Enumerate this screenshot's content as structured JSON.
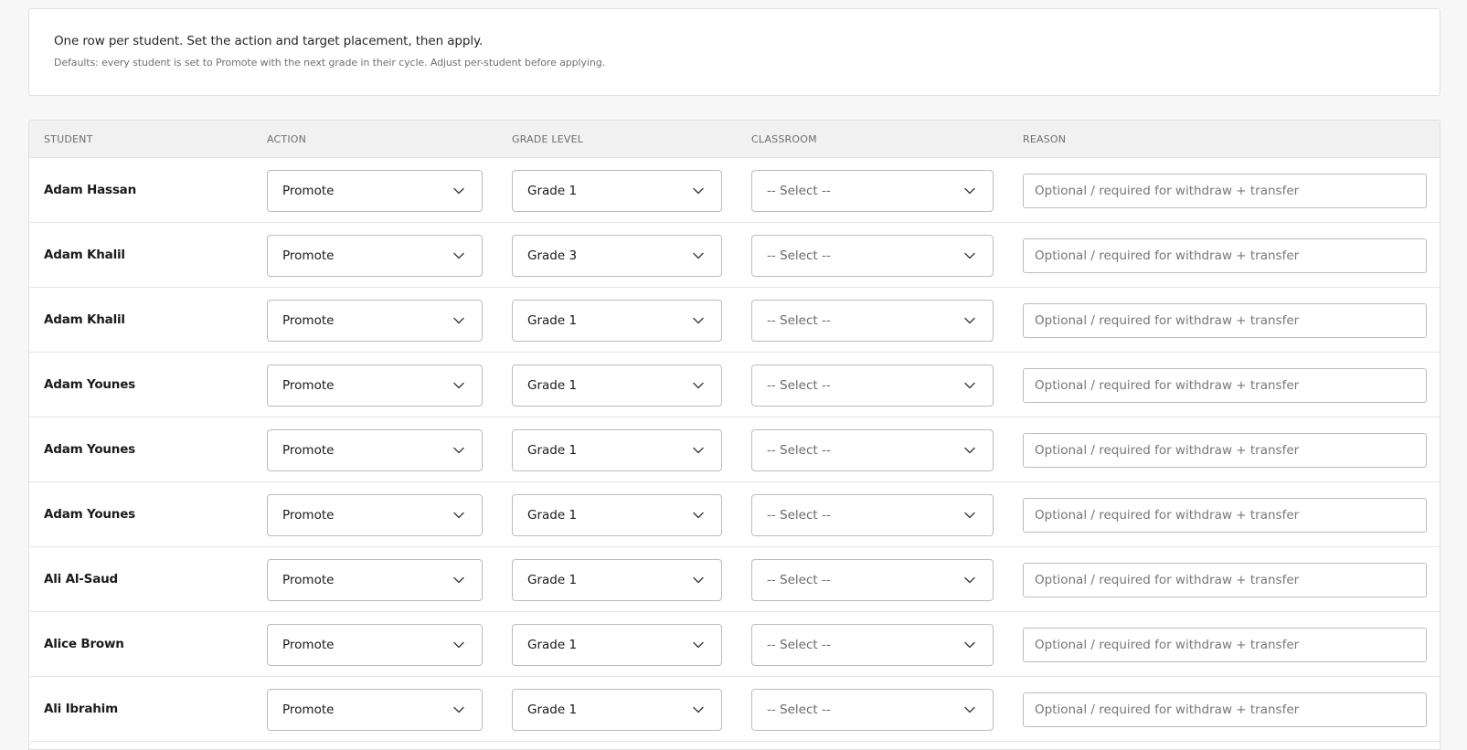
{
  "info": {
    "main": "One row per student. Set the action and target placement, then apply.",
    "sub": "Defaults: every student is set to Promote with the next grade in their cycle. Adjust per-student before applying."
  },
  "table": {
    "headers": {
      "student": "STUDENT",
      "action": "ACTION",
      "grade_level": "GRADE LEVEL",
      "classroom": "CLASSROOM",
      "reason": "REASON"
    },
    "reason_placeholder": "Optional / required for withdraw + transfer",
    "rows": [
      {
        "student": "Adam Hassan",
        "action": "Promote",
        "grade": "Grade 1",
        "classroom": "-- Select --"
      },
      {
        "student": "Adam Khalil",
        "action": "Promote",
        "grade": "Grade 3",
        "classroom": "-- Select --"
      },
      {
        "student": "Adam Khalil",
        "action": "Promote",
        "grade": "Grade 1",
        "classroom": "-- Select --"
      },
      {
        "student": "Adam Younes",
        "action": "Promote",
        "grade": "Grade 1",
        "classroom": "-- Select --"
      },
      {
        "student": "Adam Younes",
        "action": "Promote",
        "grade": "Grade 1",
        "classroom": "-- Select --"
      },
      {
        "student": "Adam Younes",
        "action": "Promote",
        "grade": "Grade 1",
        "classroom": "-- Select --"
      },
      {
        "student": "Ali Al-Saud",
        "action": "Promote",
        "grade": "Grade 1",
        "classroom": "-- Select --"
      },
      {
        "student": "Alice Brown",
        "action": "Promote",
        "grade": "Grade 1",
        "classroom": "-- Select --"
      },
      {
        "student": "Ali Ibrahim",
        "action": "Promote",
        "grade": "Grade 1",
        "classroom": "-- Select --"
      }
    ]
  },
  "icons": {
    "dropdown": "chevron-down-icon"
  }
}
